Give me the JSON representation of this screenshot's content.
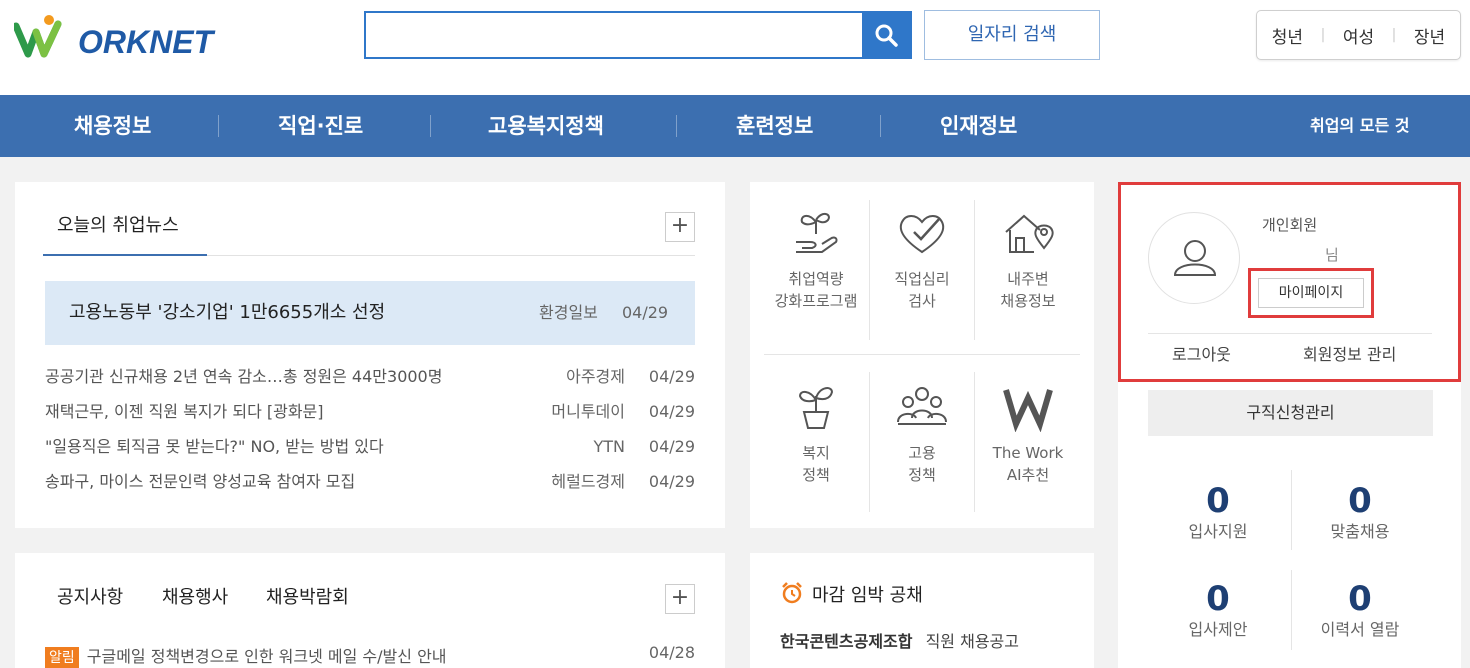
{
  "header": {
    "logo_text": "ORKNET",
    "search": {
      "value": "",
      "placeholder": ""
    },
    "job_search_label": "일자리 검색",
    "group_links": [
      "청년",
      "여성",
      "장년"
    ]
  },
  "gnb": {
    "items": [
      "채용정보",
      "직업·진로",
      "고용복지정책",
      "훈련정보",
      "인재정보"
    ],
    "right_link": "취업의 모든 것"
  },
  "news": {
    "tab": "오늘의 취업뉴스",
    "more": "+",
    "headline": {
      "title": "고용노동부 '강소기업' 1만6655개소 선정",
      "source": "환경일보",
      "date": "04/29"
    },
    "items": [
      {
        "title": "공공기관 신규채용 2년 연속 감소…총 정원은 44만3000명",
        "source": "아주경제",
        "date": "04/29"
      },
      {
        "title": "재택근무, 이젠 직원 복지가 되다 [광화문]",
        "source": "머니투데이",
        "date": "04/29"
      },
      {
        "title": "\"일용직은 퇴직금 못 받는다?\" NO, 받는 방법 있다",
        "source": "YTN",
        "date": "04/29"
      },
      {
        "title": "송파구, 마이스 전문인력 양성교육 참여자 모집",
        "source": "헤럴드경제",
        "date": "04/29"
      }
    ]
  },
  "notice": {
    "tabs": [
      "공지사항",
      "채용행사",
      "채용박람회"
    ],
    "more": "+",
    "items": [
      {
        "badge": "알림",
        "title": "구글메일 정책변경으로 인한 워크넷 메일 수/발신 안내",
        "date": "04/28"
      }
    ]
  },
  "services": [
    {
      "line1": "취업역량",
      "line2": "강화프로그램",
      "icon": "sprout-hand-icon"
    },
    {
      "line1": "직업심리",
      "line2": "검사",
      "icon": "heart-check-icon"
    },
    {
      "line1": "내주변",
      "line2": "채용정보",
      "icon": "house-location-icon"
    },
    {
      "line1": "복지",
      "line2": "정책",
      "icon": "plant-pot-icon"
    },
    {
      "line1": "고용",
      "line2": "정책",
      "icon": "people-group-icon"
    },
    {
      "line1": "The Work",
      "line2": "AI추천",
      "icon": "w-letter-icon"
    }
  ],
  "deadline": {
    "title": "마감 임박 공채",
    "items": [
      {
        "company": "한국콘텐츠공제조합",
        "title": "직원 채용공고"
      }
    ]
  },
  "member": {
    "type": "개인회원",
    "suffix": "님",
    "mypage": "마이페이지",
    "logout": "로그아웃",
    "info": "회원정보 관리",
    "apply_mgmt": "구직신청관리",
    "stats": [
      {
        "value": "0",
        "label": "입사지원"
      },
      {
        "value": "0",
        "label": "맞춤채용"
      },
      {
        "value": "0",
        "label": "입사제안"
      },
      {
        "value": "0",
        "label": "이력서 열람"
      }
    ]
  },
  "colors": {
    "brand_blue": "#3c6fb0",
    "highlight_red": "#e03c3c",
    "badge_orange": "#f07d1f"
  }
}
